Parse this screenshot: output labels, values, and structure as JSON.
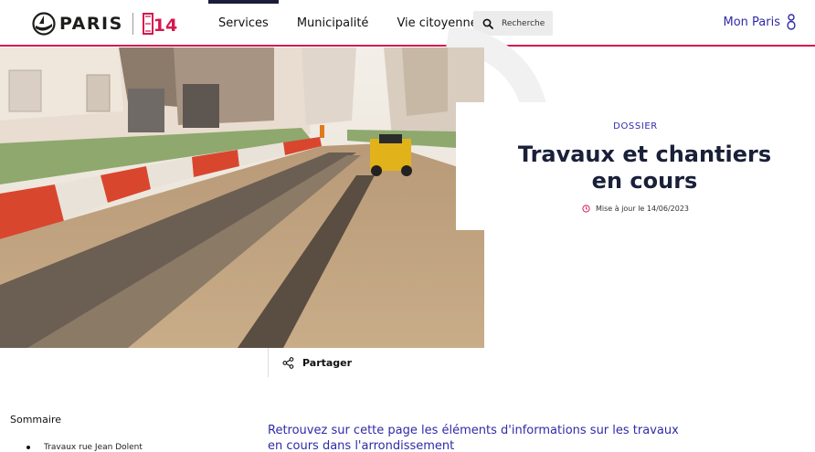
{
  "header": {
    "logo_text": "PARIS",
    "logo_badge": "14",
    "nav": [
      {
        "label": "Services",
        "active": true
      },
      {
        "label": "Municipalité",
        "active": false
      },
      {
        "label": "Vie citoyenne",
        "active": false
      }
    ],
    "search_label": "Recherche",
    "account_label": "Mon Paris",
    "accent_color": "#d5174f",
    "link_color": "#2f2aa8"
  },
  "hero": {
    "kicker": "DOSSIER",
    "title_line1": "Travaux et chantiers",
    "title_line2": "en cours",
    "updated": "Mise à jour le 14/06/2023"
  },
  "share_label": "Partager",
  "sommaire": {
    "title": "Sommaire",
    "items": [
      "Travaux rue Jean Dolent"
    ]
  },
  "intro": "Retrouvez sur cette page les éléments d'informations sur les travaux en cours dans l'arrondissement"
}
